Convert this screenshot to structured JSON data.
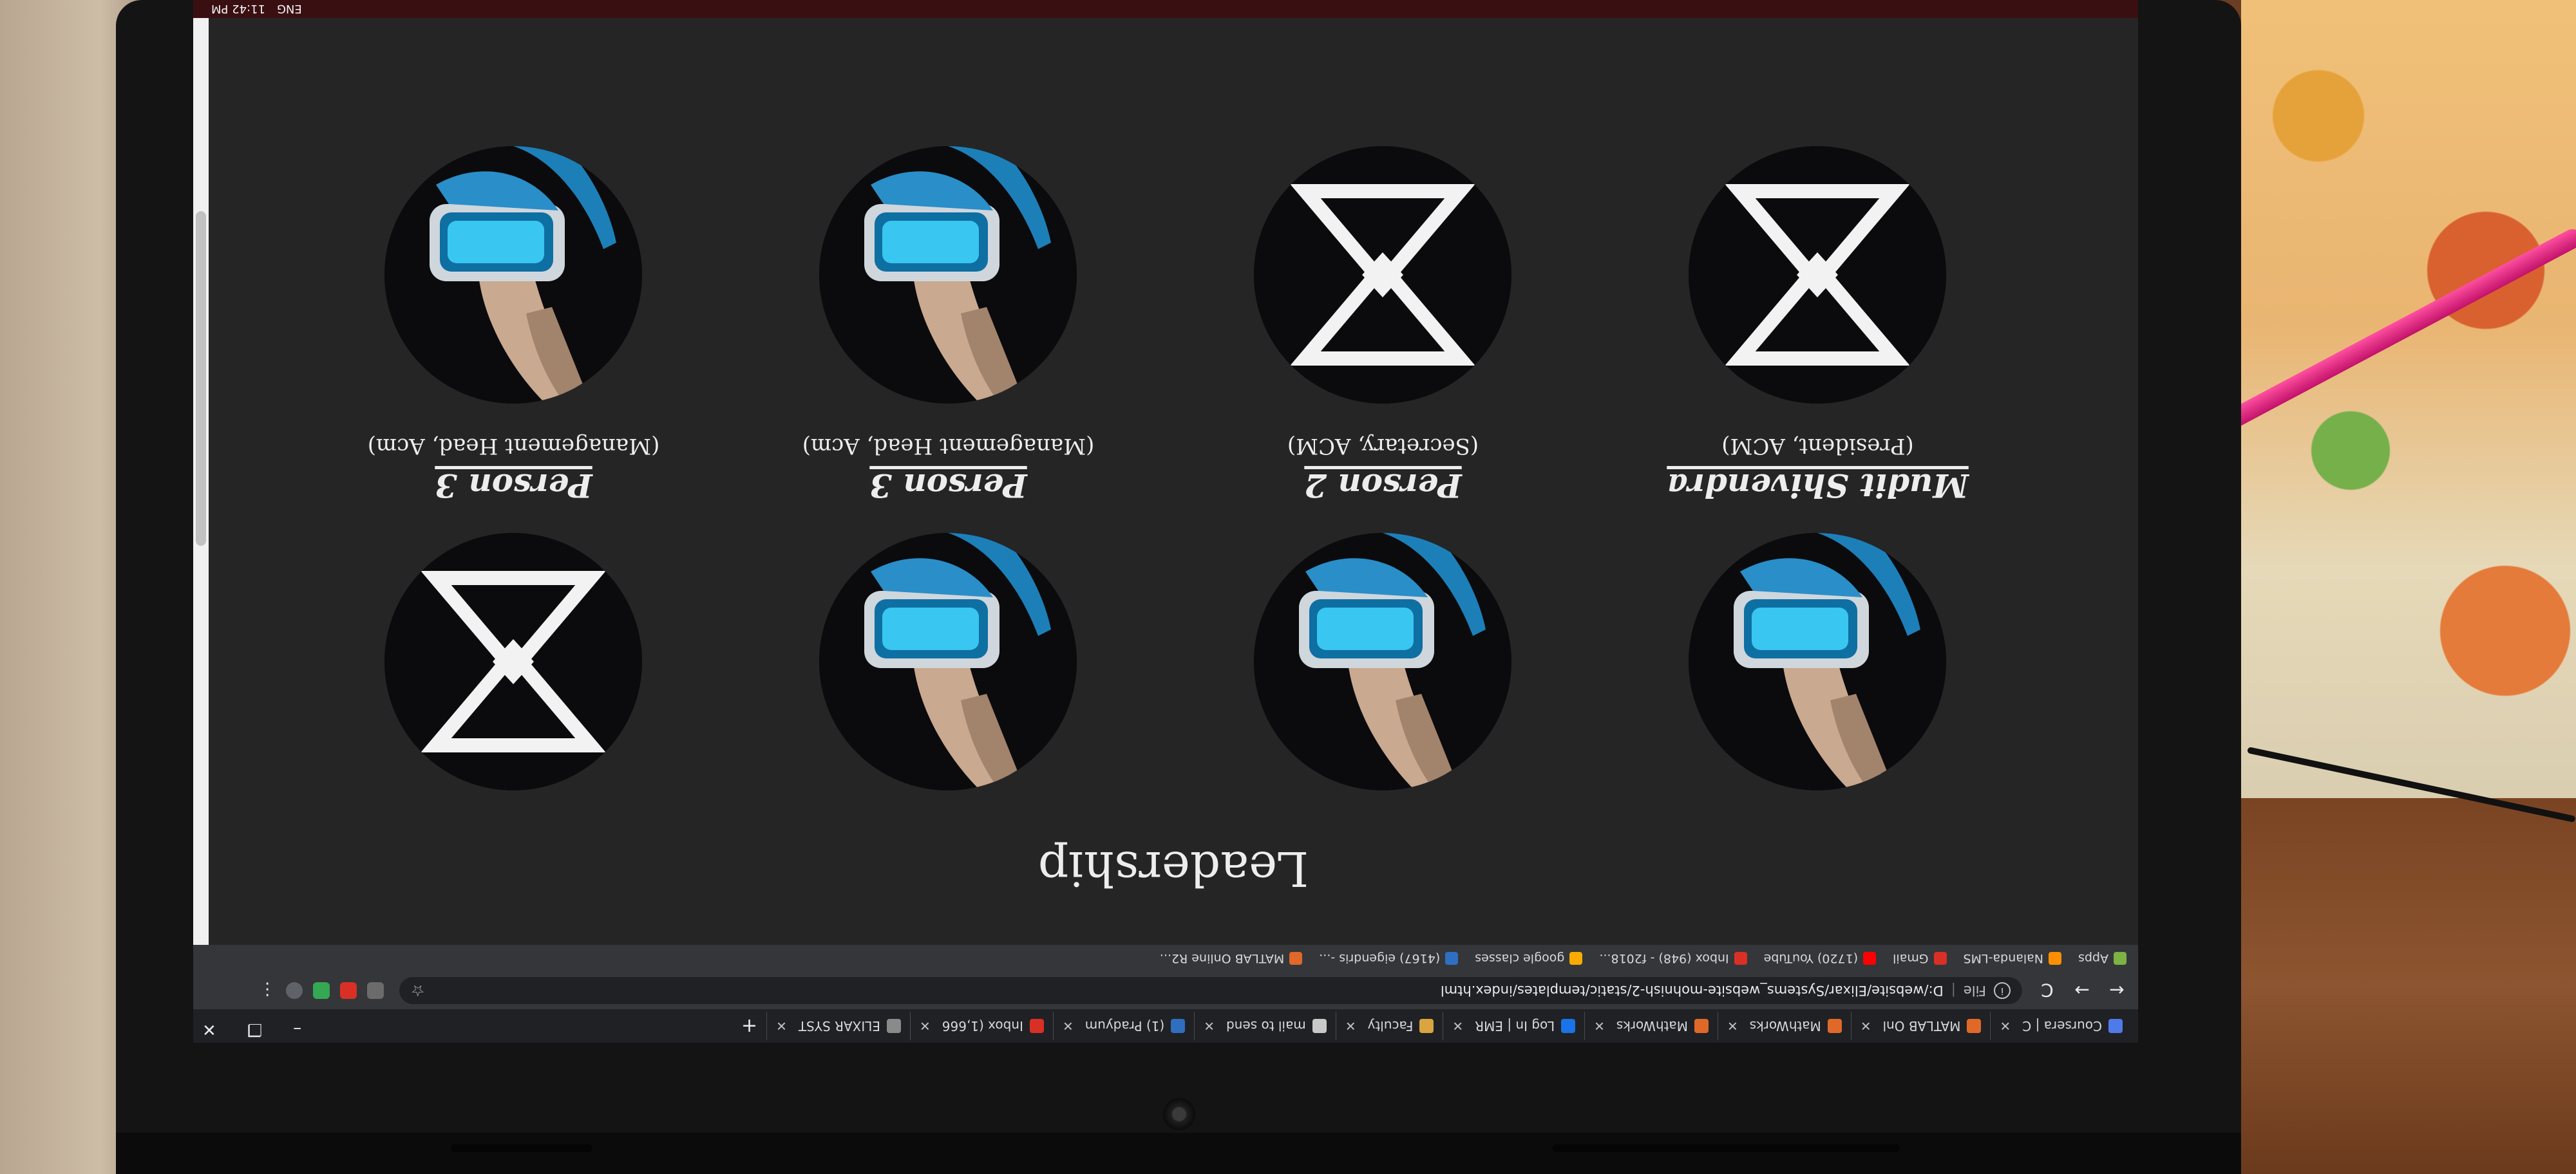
{
  "browser": {
    "tabs": [
      {
        "label": "Coursera | C",
        "color": "#4f7be8",
        "icon": "coursera-icon"
      },
      {
        "label": "MATLAB Onl",
        "color": "#e0692a",
        "icon": "matlab-icon"
      },
      {
        "label": "MathWorks",
        "color": "#e0692a",
        "icon": "matlab-icon"
      },
      {
        "label": "MathWorks",
        "color": "#e0692a",
        "icon": "matlab-icon"
      },
      {
        "label": "Log In | EMR",
        "color": "#1a73e8",
        "icon": "emr-icon"
      },
      {
        "label": "Faculty",
        "color": "#d9a441",
        "icon": "faculty-icon"
      },
      {
        "label": "mail to send",
        "color": "#c9c9c9",
        "icon": "mail-icon"
      },
      {
        "label": "(1) Pradyum",
        "color": "#2f6fc0",
        "icon": "linkedin-icon"
      },
      {
        "label": "Inbox (1,666",
        "color": "#d93025",
        "icon": "gmail-icon"
      },
      {
        "label": "ELIXAR SYST",
        "color": "#8a8a8a",
        "icon": "site-icon"
      }
    ],
    "new_tab_label": "+",
    "window_controls": {
      "minimize": "–",
      "restore": "❐",
      "close": "✕"
    },
    "nav": {
      "back": "←",
      "forward": "→",
      "reload": "C"
    },
    "address": {
      "scheme": "File",
      "url": "D:/website/Elixar/Systems_website-mohnish-2/static/templates/index.html"
    },
    "bookmarks": [
      {
        "label": "Apps",
        "color": "#7cb342",
        "icon": "apps-icon"
      },
      {
        "label": "Nalanda-LMS",
        "color": "#ff8f00",
        "icon": "nalanda-icon"
      },
      {
        "label": "Gmail",
        "color": "#d93025",
        "icon": "gmail-icon"
      },
      {
        "label": "(1720) YouTube",
        "color": "#ff0000",
        "icon": "youtube-icon"
      },
      {
        "label": "Inbox (948) - f2018...",
        "color": "#d93025",
        "icon": "gmail-icon"
      },
      {
        "label": "google classes",
        "color": "#f9ab00",
        "icon": "classroom-icon"
      },
      {
        "label": "(4167) eigendris -...",
        "color": "#2f6fc0",
        "icon": "linkedin-icon"
      },
      {
        "label": "MATLAB Online R2...",
        "color": "#e0692a",
        "icon": "matlab-icon"
      }
    ]
  },
  "page": {
    "section_title": "Leadership",
    "members": [
      {
        "name": "Mudit Shivendra",
        "role": "(President, ACM)",
        "avatar": "vr-headset"
      },
      {
        "name": "Person 2",
        "role": "(Secretary, ACM)",
        "avatar": "vr-headset"
      },
      {
        "name": "Person 3",
        "role": "(Management Head, Acm)",
        "avatar": "vr-headset"
      },
      {
        "name": "Person 3",
        "role": "(Management Head, Acm)",
        "avatar": "hourglass"
      },
      {
        "name": "",
        "role": "",
        "avatar": "hourglass"
      },
      {
        "name": "",
        "role": "",
        "avatar": "hourglass"
      },
      {
        "name": "",
        "role": "",
        "avatar": "vr-headset"
      },
      {
        "name": "",
        "role": "",
        "avatar": "vr-headset"
      }
    ]
  },
  "taskbar": {
    "lang": "ENG",
    "time": "11:42 PM"
  }
}
